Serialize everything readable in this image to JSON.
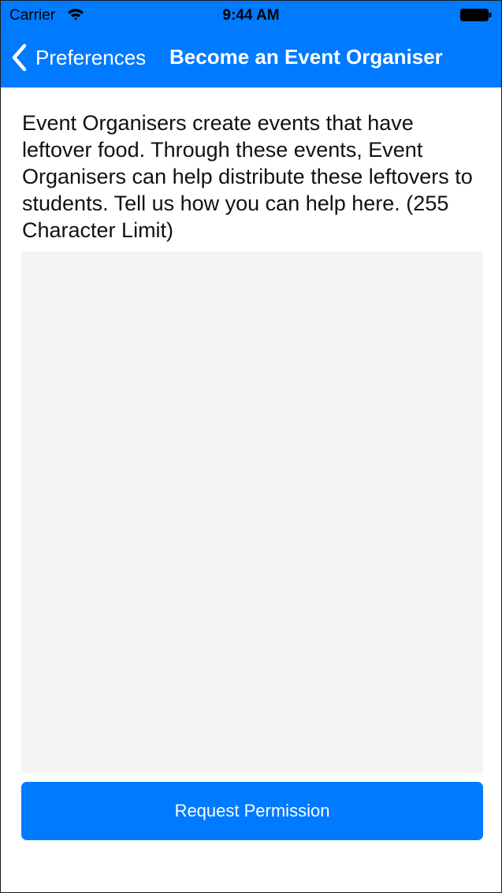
{
  "status_bar": {
    "carrier": "Carrier",
    "time": "9:44 AM",
    "wifi_icon": "wifi-icon",
    "battery_icon": "battery-icon"
  },
  "nav": {
    "back_label": "Preferences",
    "back_icon": "chevron-left-icon",
    "title": "Become an Event Organiser",
    "background_color": "#007aff"
  },
  "main": {
    "description": "Event Organisers create events that have leftover food. Through these events, Event Organisers can help distribute these leftovers to students. Tell us how you can help here.  (255 Character Limit)",
    "input_value": "",
    "submit_label": "Request Permission",
    "accent_color": "#007aff"
  }
}
